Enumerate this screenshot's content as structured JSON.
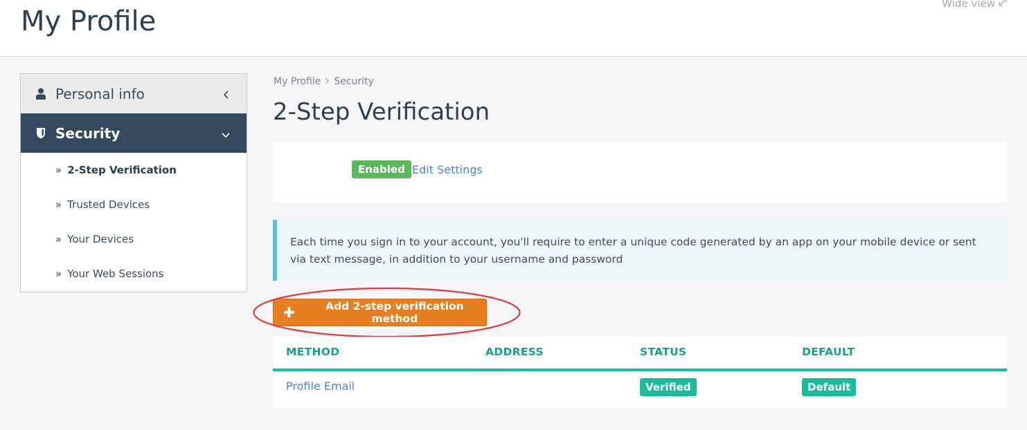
{
  "header": {
    "title": "My Profile",
    "wide_view": "Wide view"
  },
  "sidebar": {
    "personal_info": "Personal info",
    "security": "Security",
    "items": [
      {
        "label": "2-Step Verification",
        "active": true
      },
      {
        "label": "Trusted Devices",
        "active": false
      },
      {
        "label": "Your Devices",
        "active": false
      },
      {
        "label": "Your Web Sessions",
        "active": false
      }
    ]
  },
  "breadcrumb": [
    "My Profile",
    "Security"
  ],
  "section": {
    "title": "2-Step Verification",
    "status_badge": "Enabled",
    "edit_link": "Edit Settings",
    "info": "Each time you sign in to your account, you'll require to enter a unique code generated by an app on your mobile device or sent via text message, in addition to your username and password",
    "add_button": "Add 2-step verification method"
  },
  "table": {
    "headers": [
      "METHOD",
      "ADDRESS",
      "STATUS",
      "DEFAULT"
    ],
    "rows": [
      {
        "method": "Profile Email",
        "address": "",
        "status": "Verified",
        "default": "Default"
      }
    ]
  },
  "colors": {
    "primary_dark": "#34495e",
    "enabled_green": "#5cb85c",
    "teal": "#1abc9c",
    "orange": "#e67e22",
    "info_border": "#5bc0de",
    "annotation_red": "#e0393e"
  }
}
